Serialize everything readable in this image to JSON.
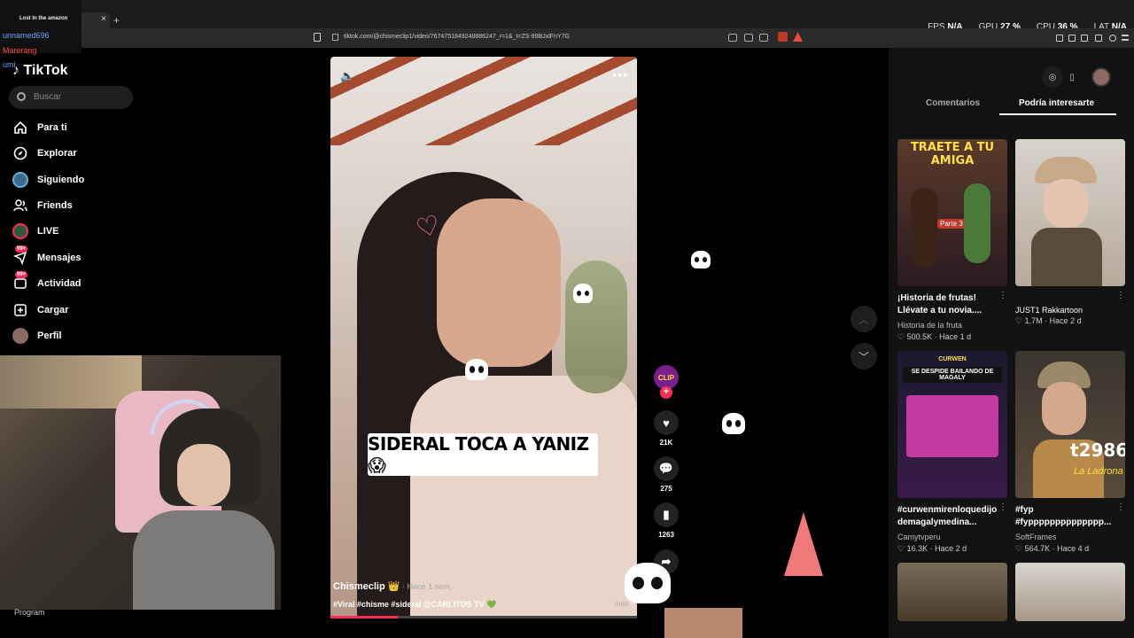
{
  "browser": {
    "tab_close": "×",
    "new_tab": "+",
    "url": "tiktok.com/@chismeclip1/video/7674751849248886247_r=1&_t=ZS-99BJxlFnY7G",
    "metrics": [
      {
        "label": "FPS",
        "value": "N/A"
      },
      {
        "label": "GPU",
        "value": "27 %"
      },
      {
        "label": "CPU",
        "value": "36 %"
      },
      {
        "label": "LAT",
        "value": "N/A"
      }
    ]
  },
  "chat": {
    "lines": [
      "Lost In the amazon",
      "unnamed696",
      "Marerang",
      "umi"
    ]
  },
  "sidebar": {
    "logo": "TikTok",
    "search_placeholder": "Buscar",
    "items": [
      {
        "label": "Para ti",
        "icon": "home-icon"
      },
      {
        "label": "Explorar",
        "icon": "compass-icon"
      },
      {
        "label": "Siguiendo",
        "icon": "following-icon"
      },
      {
        "label": "Friends",
        "icon": "friends-icon"
      },
      {
        "label": "LIVE",
        "icon": "live-icon"
      },
      {
        "label": "Mensajes",
        "icon": "messages-icon",
        "badge": "99+"
      },
      {
        "label": "Actividad",
        "icon": "activity-icon",
        "badge": "99+"
      },
      {
        "label": "Cargar",
        "icon": "upload-icon"
      },
      {
        "label": "Perfil",
        "icon": "avatar"
      }
    ]
  },
  "webcam": {
    "program_label": "Program"
  },
  "video": {
    "caption_overlay": "SIDERAL TOCA A YANIZ😱",
    "author": "Chismeclip",
    "author_badge": "👑",
    "posted": "· Hace 1 sem.",
    "tags": "#Viral #chisme #sideral @CARLITOS TV 💚",
    "more": "más",
    "progress": 0.22
  },
  "actions": {
    "likes": "21K",
    "comments": "275",
    "saves": "1263"
  },
  "right_panel": {
    "tabs": [
      "Comentarios",
      "Podría interesarte"
    ],
    "cards": [
      {
        "title": "¡Historia de frutas! Llévate a tu novia....",
        "creator": "Historia de la fruta",
        "stats": "♡ 500.5K · Hace 1 d",
        "thumb_text": "TRAETE A TU AMIGA",
        "thumb_sub": "Parte 3"
      },
      {
        "title": "JUST1 Rakkartoon",
        "creator": "",
        "stats": "♡ 1.7M · Hace 2 d",
        "thumb_text": "",
        "thumb_sub": ""
      },
      {
        "title": "#curwenmirenloquedijo demagalymedina...",
        "creator": "Camytvperu",
        "stats": "♡ 16.3K · Hace 2 d",
        "thumb_text": "SE DESPIDE BAILANDO DE MAGALY",
        "thumb_sub": "CURWEN"
      },
      {
        "title": "#fyp #fypppppppppppppp...",
        "creator": "SoftFrames",
        "stats": "♡ 564.7K · Hace 4 d",
        "thumb_text": "t2986",
        "thumb_sub": "La Ladrona"
      }
    ]
  }
}
